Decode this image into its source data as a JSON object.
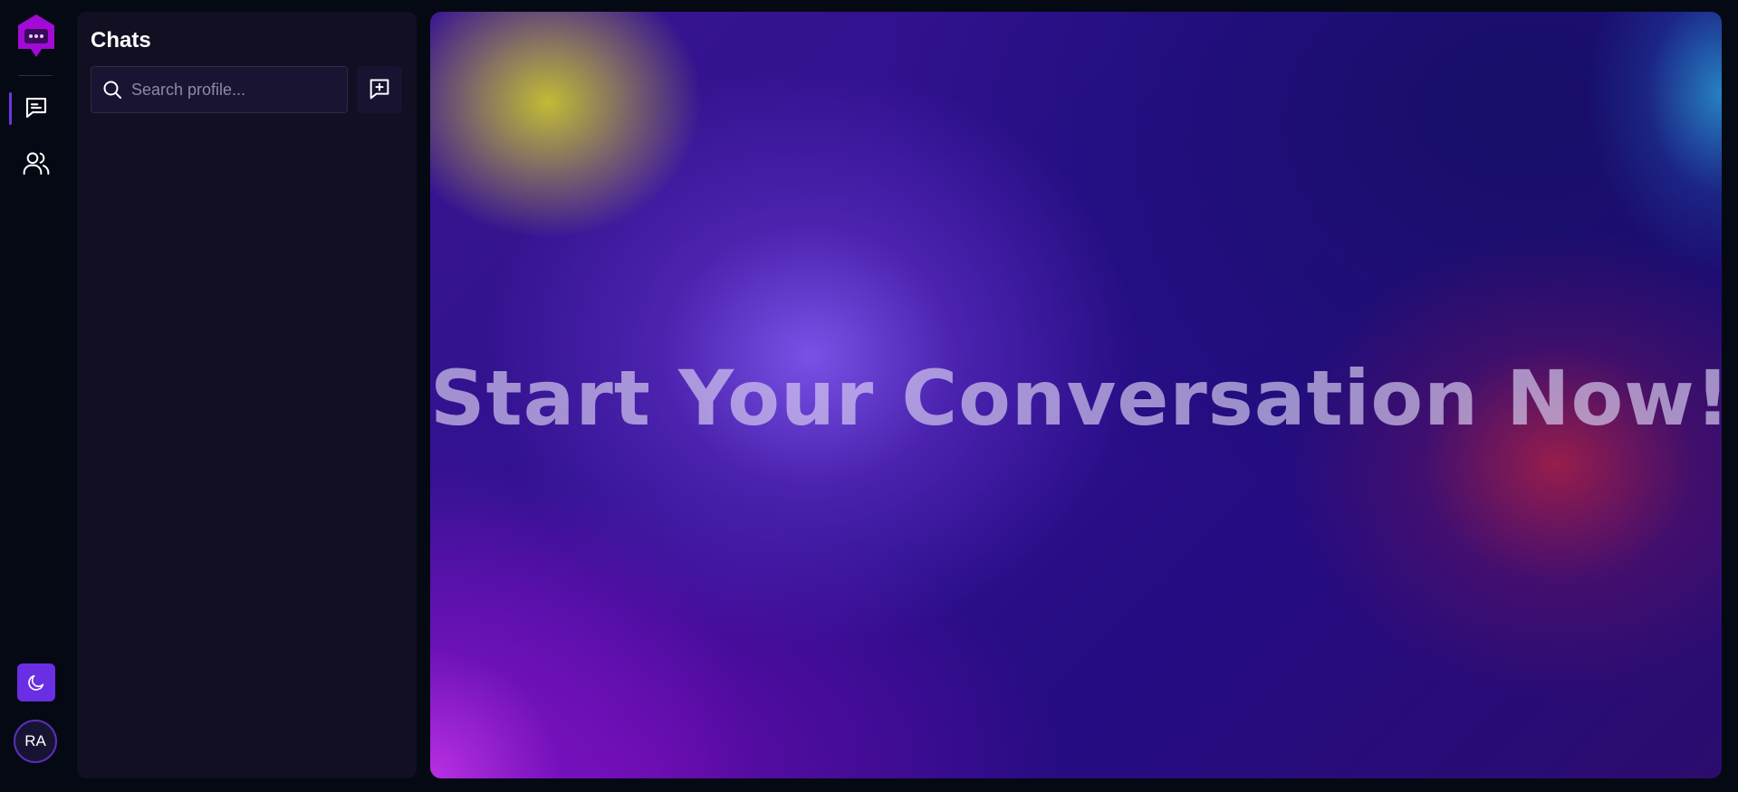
{
  "colors": {
    "app_background": "#050914",
    "panel_background": "#120f22",
    "accent": "#6a2ee3",
    "logo": "#a20bd6"
  },
  "rail": {
    "items": [
      {
        "name": "chats",
        "icon": "chat-message-icon",
        "active": true
      },
      {
        "name": "contacts",
        "icon": "users-icon",
        "active": false
      }
    ],
    "theme_toggle_icon": "moon-icon",
    "avatar_initials": "RA"
  },
  "chats_panel": {
    "title": "Chats",
    "search_placeholder": "Search profile...",
    "new_chat_icon": "message-plus-icon"
  },
  "main": {
    "headline": "Start Your Conversation Now!"
  }
}
